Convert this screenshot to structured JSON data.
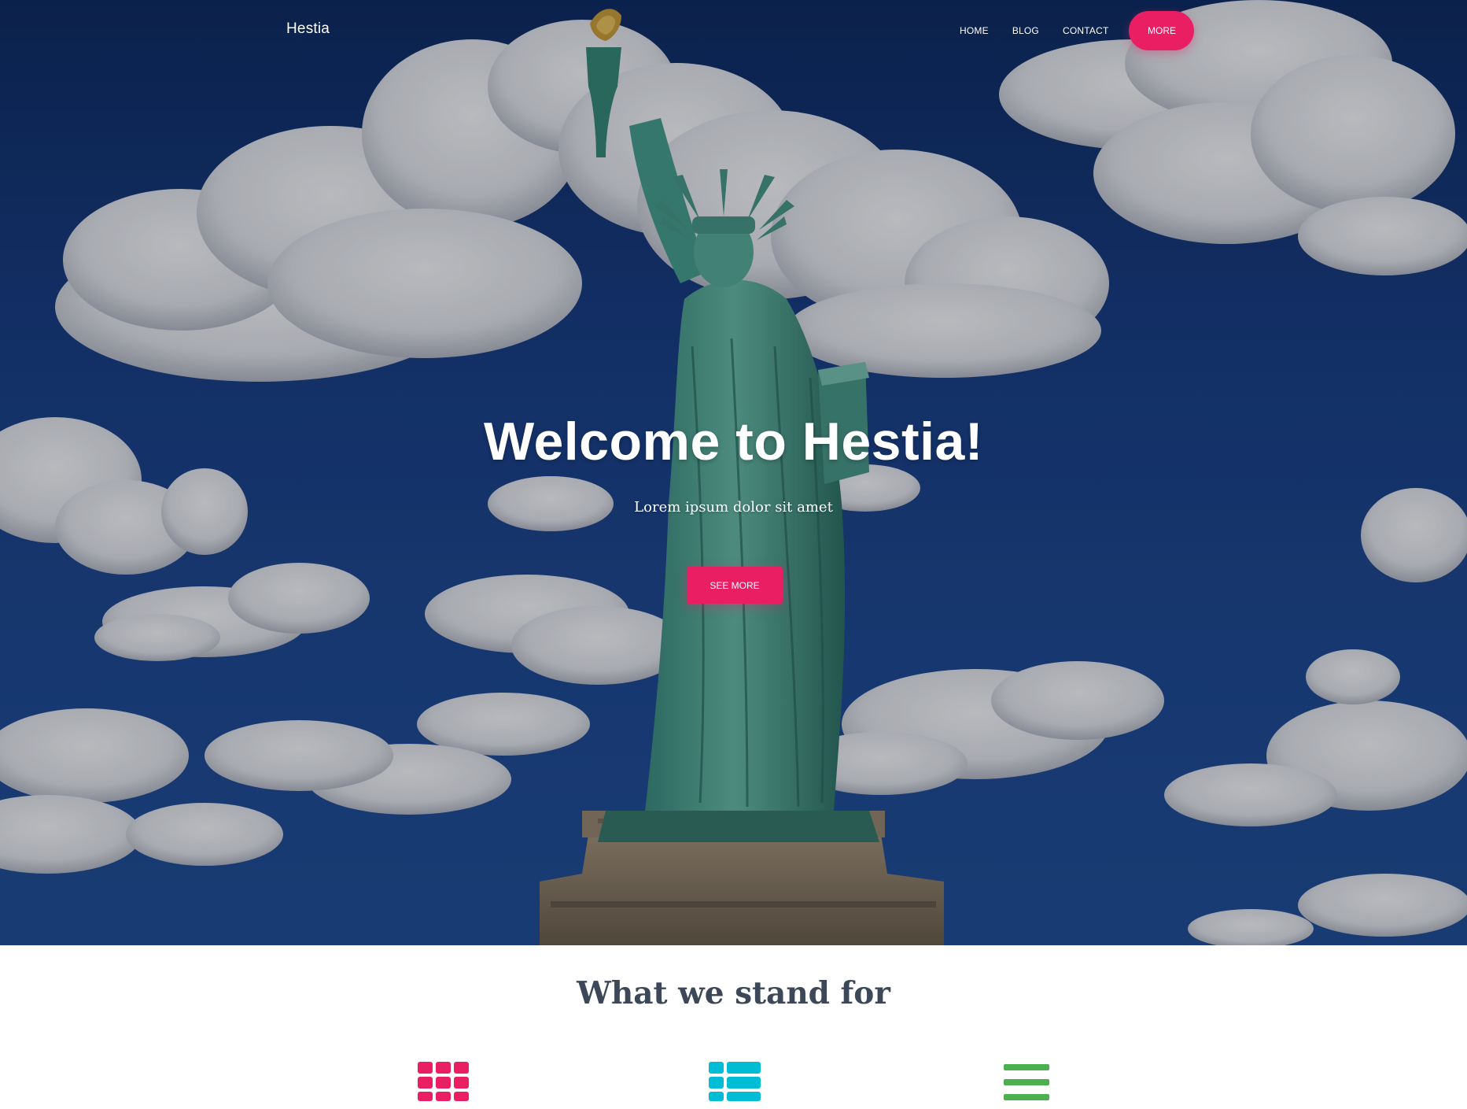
{
  "navbar": {
    "brand": "Hestia",
    "links": [
      {
        "label": "HOME"
      },
      {
        "label": "BLOG"
      },
      {
        "label": "CONTACT"
      }
    ],
    "more_label": "MORE"
  },
  "hero": {
    "title": "Welcome to Hestia!",
    "subtitle": "Lorem ipsum dolor sit amet",
    "button_label": "SEE MORE"
  },
  "features": {
    "title": "What we stand for",
    "icons": [
      {
        "name": "grid-icon",
        "color": "#e91e63"
      },
      {
        "name": "view-list-icon",
        "color": "#00bcd4"
      },
      {
        "name": "menu-lines-icon",
        "color": "#4caf50"
      }
    ]
  },
  "colors": {
    "accent": "#e91e63",
    "info": "#00bcd4",
    "success": "#4caf50",
    "heading": "#3c4858"
  }
}
